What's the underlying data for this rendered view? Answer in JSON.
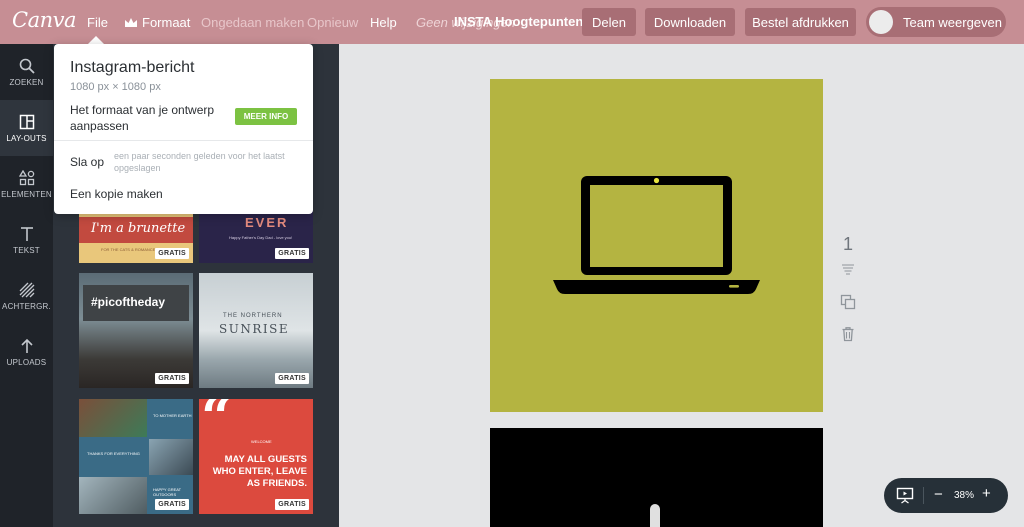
{
  "topbar": {
    "logo": "Canva",
    "file": "File",
    "format": "Formaat",
    "undo": "Ongedaan maken",
    "redo": "Opnieuw",
    "help": "Help",
    "unsaved": "Geen wijzigingen",
    "doc_title": "INSTA Hoogtepunten",
    "share": "Delen",
    "download": "Downloaden",
    "print": "Bestel afdrukken",
    "team": "Team weergeven"
  },
  "rail": {
    "items": [
      {
        "label": "ZOEKEN",
        "icon": "search-icon"
      },
      {
        "label": "LAY-OUTS",
        "icon": "layouts-icon",
        "active": true
      },
      {
        "label": "ELEMENTEN",
        "icon": "elements-icon"
      },
      {
        "label": "TEKST",
        "icon": "text-icon"
      },
      {
        "label": "ACHTERGR.",
        "icon": "background-icon"
      },
      {
        "label": "UPLOADS",
        "icon": "upload-icon"
      }
    ]
  },
  "dropdown": {
    "title": "Instagram-bericht",
    "size": "1080 px × 1080 px",
    "resize": "Het formaat van je ontwerp aanpassen",
    "more_info": "MEER INFO",
    "save": "Sla op",
    "saved_note": "een paar seconden geleden voor het laatst opgeslagen",
    "copy": "Een kopie maken"
  },
  "templates": {
    "badge": "GRATIS",
    "t1": {
      "title": "I'm a brunette",
      "small": "FOR THE CATS & ROMANCE"
    },
    "t2": {
      "title": "EVER",
      "small": "Happy Father's Day Dad - love you!"
    },
    "t3": {
      "title": "#picoftheday"
    },
    "t4": {
      "line1": "THE NORTHERN",
      "line2": "SUNRISE"
    },
    "t5": {
      "w1": "TO MOTHER EARTH",
      "w2": "THANKS FOR EVERYTHING",
      "w3": "HAPPY GREAT OUTDOORS"
    },
    "t6": {
      "quote": "“",
      "small": "WELCOME",
      "text": "MAY ALL GUESTS WHO ENTER, LEAVE AS FRIENDS."
    }
  },
  "canvas": {
    "page_number": "1",
    "design_bg": "#b4b441"
  },
  "zoom": {
    "minus": "−",
    "value": "38%",
    "plus": "+"
  }
}
